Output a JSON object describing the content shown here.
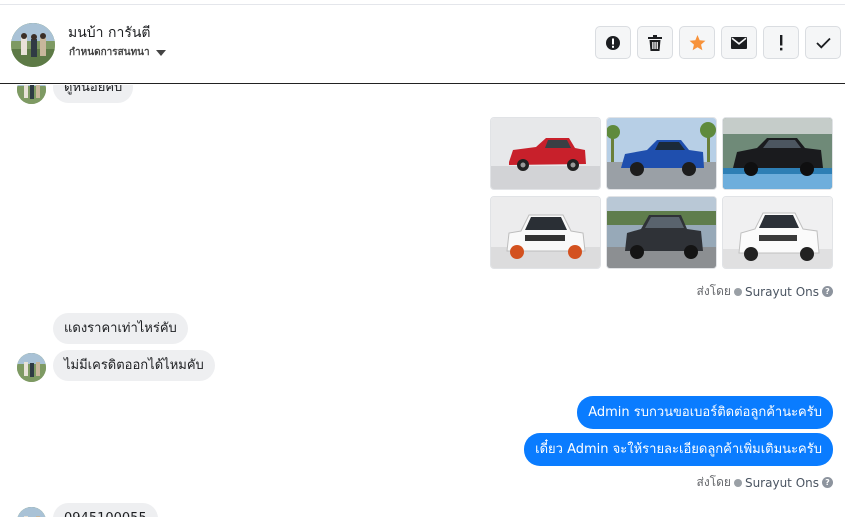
{
  "header": {
    "contact_name": "มนบ้า การันตี",
    "conversation_status": "กำหนดการสนทนา",
    "actions": [
      {
        "name": "report-button",
        "icon": "alert-circle-icon"
      },
      {
        "name": "delete-button",
        "icon": "trash-icon"
      },
      {
        "name": "star-button",
        "icon": "star-icon"
      },
      {
        "name": "mark-unread-button",
        "icon": "envelope-icon"
      },
      {
        "name": "spam-button",
        "icon": "exclamation-icon"
      },
      {
        "name": "done-button",
        "icon": "checkmark-icon"
      }
    ]
  },
  "messages": {
    "partial_top": "ดูหน่อยคับ",
    "photos": [
      {
        "alt": "red pickup truck",
        "icon": "photo-red-truck"
      },
      {
        "alt": "blue pickup truck",
        "icon": "photo-blue-truck"
      },
      {
        "alt": "black pickup truck",
        "icon": "photo-black-truck"
      },
      {
        "alt": "white pickup truck",
        "icon": "photo-white-truck"
      },
      {
        "alt": "dark grey pickup truck",
        "icon": "photo-grey-truck"
      },
      {
        "alt": "white pickup truck",
        "icon": "photo-white-truck-2"
      }
    ],
    "sent_by_prefix": "ส่งโดย",
    "sent_by_name": "Surayut Ons",
    "sent_by_help": "?",
    "incoming_1": "แดงราคาเท่าไหร่คับ",
    "incoming_2": "ไม่มีเครดิตออกได้ไหมคับ",
    "outgoing_1": "Admin รบกวนขอเบอร์ติดต่อลูกค้านะครับ",
    "outgoing_2": "เดี๋ยว Admin จะให้รายละเอียดลูกค้าเพิ่มเติมนะครับ",
    "partial_bottom": "0945100055"
  },
  "colors": {
    "accent": "#0a7cff",
    "star": "#f7923a",
    "incoming_bubble": "#eeeff1"
  }
}
